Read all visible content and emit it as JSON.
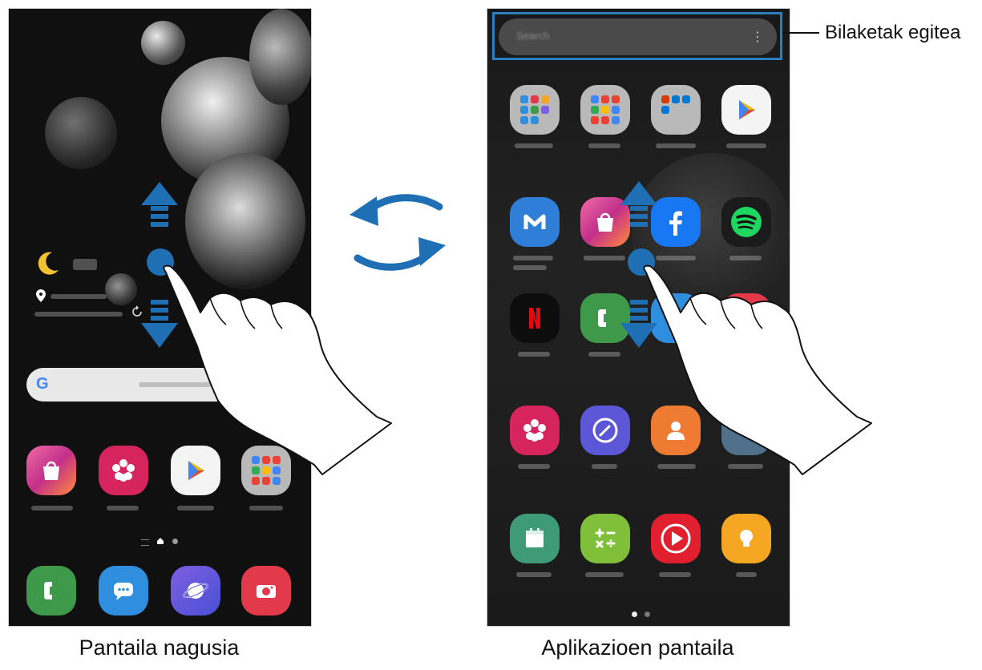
{
  "home_screen": {
    "caption": "Pantaila nagusia",
    "weather_icon": "moon-icon",
    "location_icon": "location-pin-icon",
    "refresh_icon": "refresh-icon",
    "search_icon": "google-g-icon",
    "search_logo": "G",
    "page_indicator": [
      "apps-list-icon",
      "home-dot-icon",
      "page-dot-icon"
    ],
    "apps_row": [
      "galaxy-store-icon",
      "gallery-icon",
      "play-store-icon",
      "google-folder-icon"
    ],
    "dock": [
      "phone-icon",
      "messages-icon",
      "internet-icon",
      "camera-icon"
    ]
  },
  "apps_screen": {
    "caption": "Aplikazioen pantaila",
    "search_menu_glyph": "⋮",
    "callout_label": "Bilaketak egitea",
    "page_dots": 2,
    "rows": [
      [
        "samsung-folder-icon",
        "google-folder-icon",
        "microsoft-folder-icon",
        "play-store-icon"
      ],
      [
        "samsung-members-icon",
        "galaxy-store-icon",
        "facebook-icon",
        "spotify-icon"
      ],
      [
        "netflix-icon",
        "phone-icon",
        "messages-icon",
        "youtube-music-icon"
      ],
      [
        "gallery-icon",
        "clock-icon",
        "contacts-icon",
        "settings-icon"
      ],
      [
        "calendar-icon",
        "calculator-icon",
        "video-player-icon",
        "tips-icon"
      ]
    ]
  },
  "gestures": {
    "swipe_arrows": [
      "swipe-up-arrow-icon",
      "swipe-down-arrow-icon"
    ],
    "switch_icon": "circular-switch-arrows-icon"
  },
  "colors": {
    "accent_blue": "#1f6fb5",
    "callout_blue": "#2a7fc0"
  }
}
